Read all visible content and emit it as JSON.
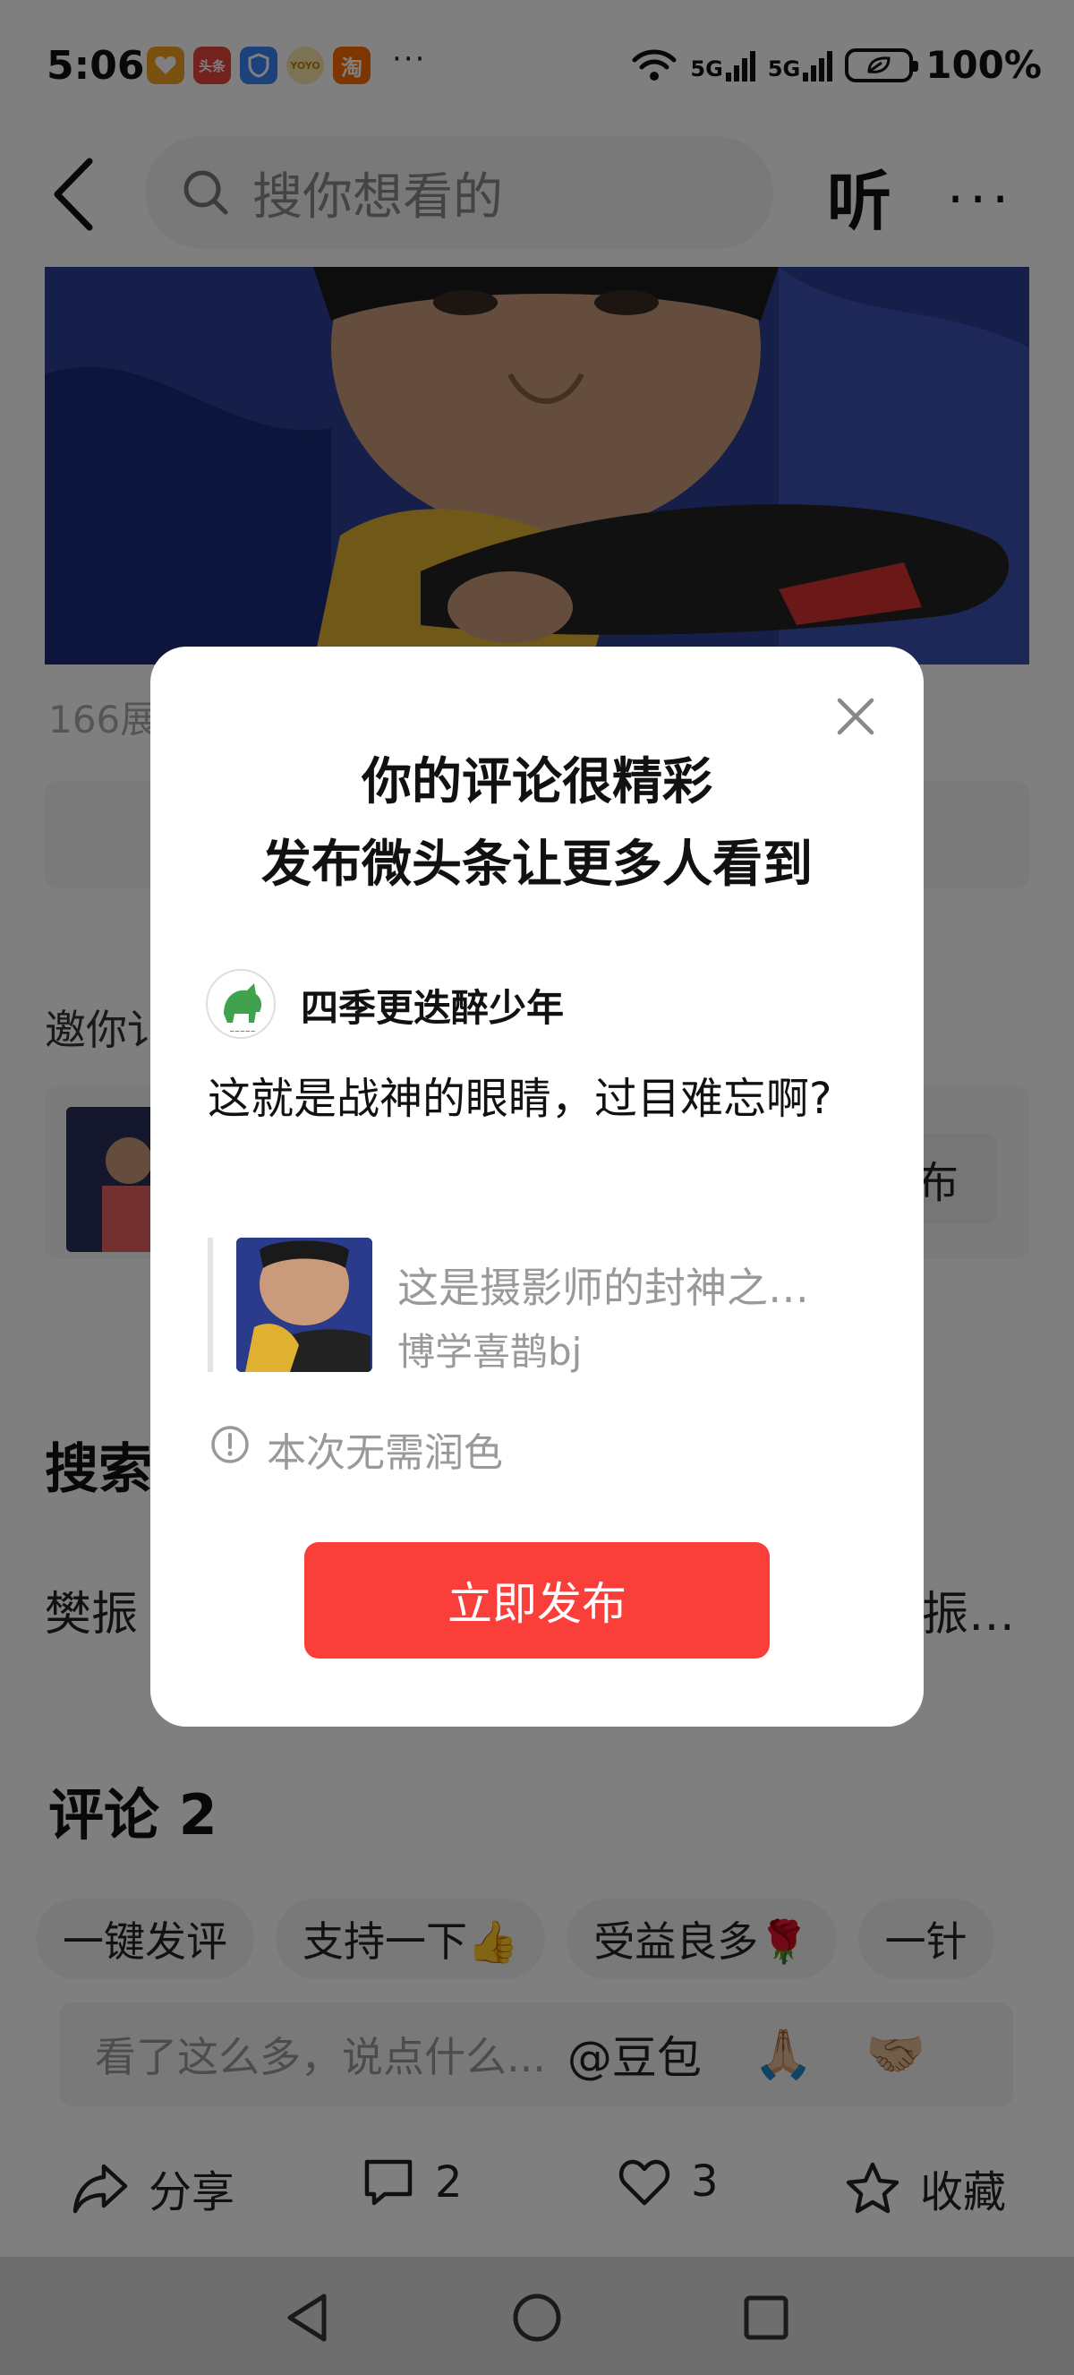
{
  "status_bar": {
    "time": "5:06",
    "app_icons": [
      {
        "name": "heart-app-icon",
        "label": "",
        "color": "#f5a020"
      },
      {
        "name": "toutiao-app-icon",
        "label": "头条",
        "color": "#e8453c"
      },
      {
        "name": "shield-app-icon",
        "label": "",
        "color": "#3b82f6"
      },
      {
        "name": "yoyo-app-icon",
        "label": "YOYO",
        "color": "#f0c020"
      },
      {
        "name": "taobao-app-icon",
        "label": "淘",
        "color": "#ff6a00"
      }
    ],
    "more": "···",
    "network1": "5G",
    "network2": "5G",
    "battery": "100%"
  },
  "header": {
    "search_placeholder": "搜你想看的",
    "listen_label": "听",
    "more_label": "···"
  },
  "article": {
    "views": "166展",
    "invite_label": "邀你讠",
    "invite_button": "布",
    "search_heading": "搜索",
    "related_left": "樊振",
    "related_right": "振…",
    "comments_heading": "评论 2"
  },
  "quick_comments": [
    "一键发评",
    "支持一下👍",
    "受益良多🌹",
    "一针"
  ],
  "comment_input": {
    "placeholder": "看了这么多，说点什么...",
    "at_label": "@豆包",
    "emoji1": "🙏🏼",
    "emoji2": "🤝🏼"
  },
  "bottom_bar": {
    "share_label": "分享",
    "comment_count": "2",
    "like_count": "3",
    "favorite_label": "收藏"
  },
  "modal": {
    "title_line1": "你的评论很精彩",
    "title_line2": "发布微头条让更多人看到",
    "username": "四季更迭醉少年",
    "comment_text": "这就是战神的眼睛，过目难忘啊?",
    "quote_title": "这是摄影师的封神之…",
    "quote_author": "博学喜鹊bj",
    "info_text": "本次无需润色",
    "publish_button": "立即发布"
  },
  "colors": {
    "accent_red": "#fa3e3a",
    "overlay": "rgba(0,0,0,0.5)"
  }
}
